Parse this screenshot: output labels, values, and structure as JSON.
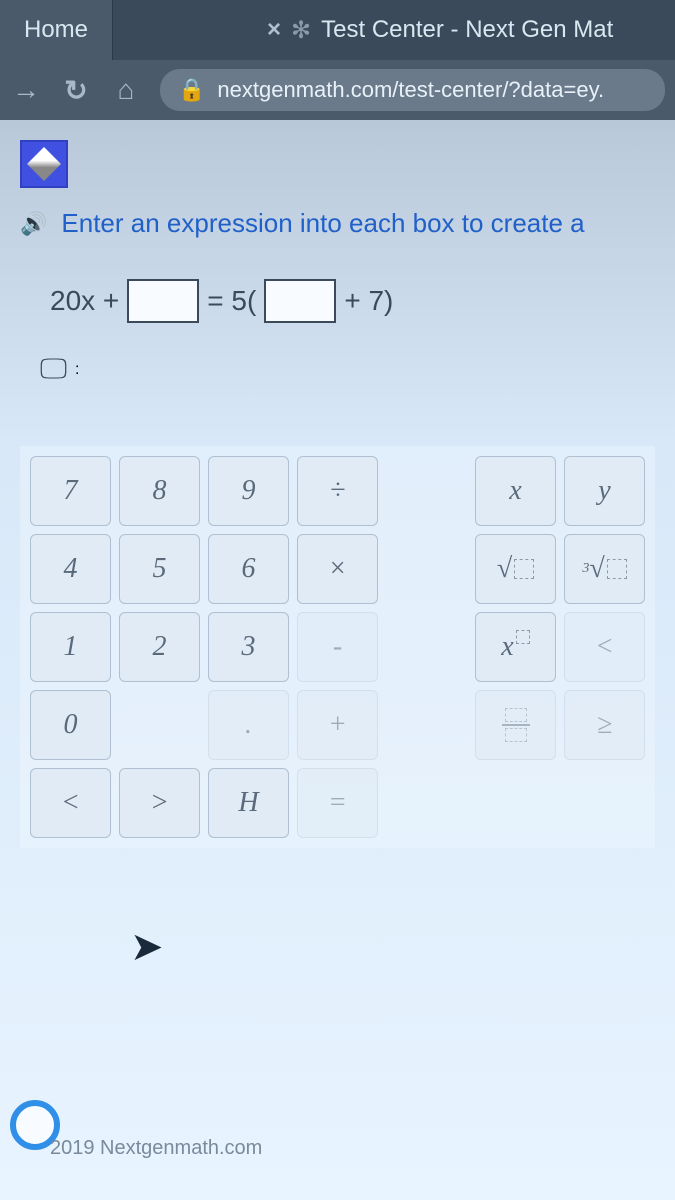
{
  "tabs": {
    "home": "Home",
    "test": "Test Center - Next Gen Mat"
  },
  "url": "nextgenmath.com/test-center/?data=ey.",
  "instruction": "Enter an expression into each box to create a",
  "equation": {
    "left_prefix": "20x +",
    "mid": "= 5(",
    "right_suffix": "+ 7)"
  },
  "chat_suffix": ":",
  "keypad": {
    "r1": [
      "7",
      "8",
      "9",
      "÷",
      "x",
      "y"
    ],
    "r2": [
      "4",
      "5",
      "6",
      "×"
    ],
    "r3": [
      "1",
      "2",
      "3",
      "-",
      "<"
    ],
    "r4": [
      "0",
      "",
      ".",
      "+",
      "≥"
    ],
    "r5": [
      "<",
      ">",
      "H",
      "="
    ]
  },
  "labels": {
    "sqrt": "√",
    "nthroot_sup": "3",
    "exp_base": "x"
  },
  "footer": "2019 Nextgenmath.com"
}
